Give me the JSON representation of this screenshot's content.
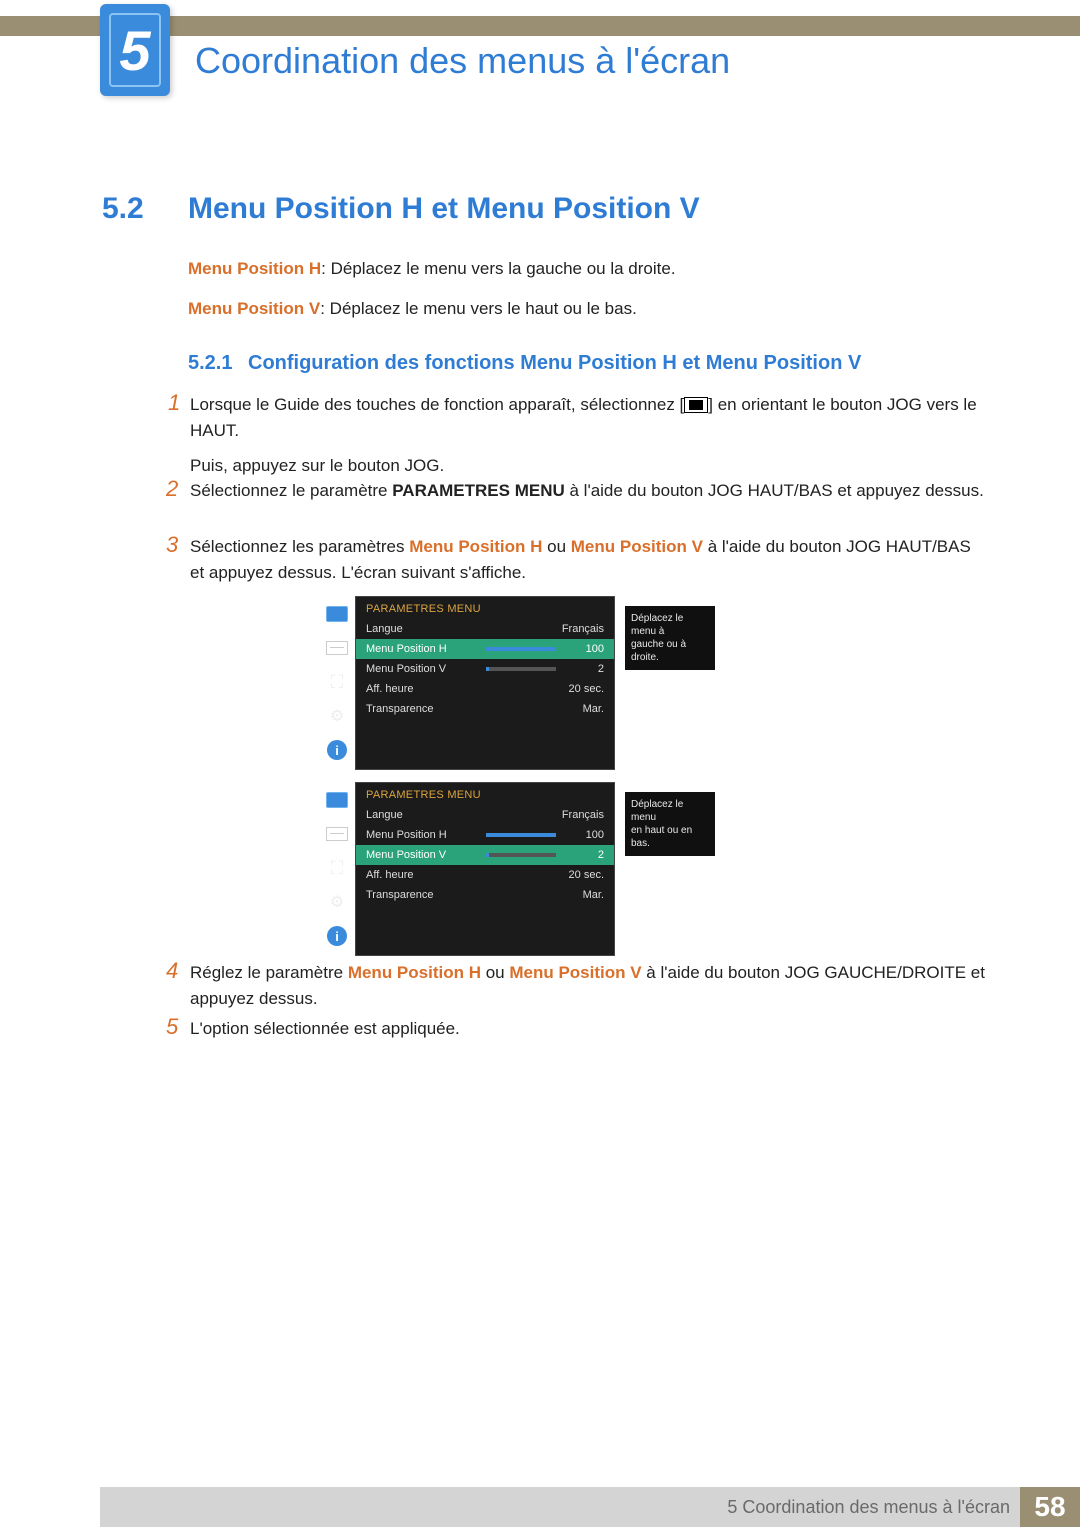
{
  "chapter": {
    "number": "5",
    "title": "Coordination des menus à l'écran"
  },
  "section": {
    "number": "5.2",
    "title": "Menu Position H et Menu Position V"
  },
  "definitions": {
    "h_label": "Menu Position H",
    "h_text": ": Déplacez le menu vers la gauche ou la droite.",
    "v_label": "Menu Position V",
    "v_text": ": Déplacez le menu vers le haut ou le bas."
  },
  "subsection": {
    "number": "5.2.1",
    "title": "Configuration des fonctions Menu Position H et Menu Position V"
  },
  "steps": {
    "s1a": "Lorsque le Guide des touches de fonction apparaît, sélectionnez [",
    "s1b": "] en orientant le bouton JOG vers le HAUT.",
    "s1c": "Puis, appuyez sur le bouton JOG.",
    "s2a": "Sélectionnez le paramètre ",
    "s2b": "PARAMETRES MENU",
    "s2c": " à l'aide du bouton JOG HAUT/BAS et appuyez dessus.",
    "s3a": "Sélectionnez les paramètres ",
    "s3_h": "Menu Position H",
    "s3_or": " ou ",
    "s3_v": "Menu Position V",
    "s3b": " à l'aide du bouton JOG HAUT/BAS et appuyez dessus. L'écran suivant s'affiche.",
    "s4a": "Réglez le paramètre ",
    "s4b": " à l'aide du bouton JOG GAUCHE/DROITE et appuyez dessus.",
    "s5": "L'option sélectionnée est appliquée.",
    "n1": "1",
    "n2": "2",
    "n3": "3",
    "n4": "4",
    "n5": "5"
  },
  "osd": {
    "header": "PARAMETRES MENU",
    "rows": {
      "langue_label": "Langue",
      "langue_val": "Français",
      "h_label": "Menu Position H",
      "h_val": "100",
      "v_label": "Menu Position V",
      "v_val": "2",
      "aff_label": "Aff. heure",
      "aff_val": "20 sec.",
      "trans_label": "Transparence",
      "trans_val": "Mar."
    },
    "tooltip1a": "Déplacez le menu à",
    "tooltip1b": "gauche ou à droite.",
    "tooltip2a": "Déplacez le menu",
    "tooltip2b": "en haut ou en bas.",
    "info_i": "i"
  },
  "footer": {
    "text": "5 Coordination des menus à l'écran",
    "page": "58"
  }
}
